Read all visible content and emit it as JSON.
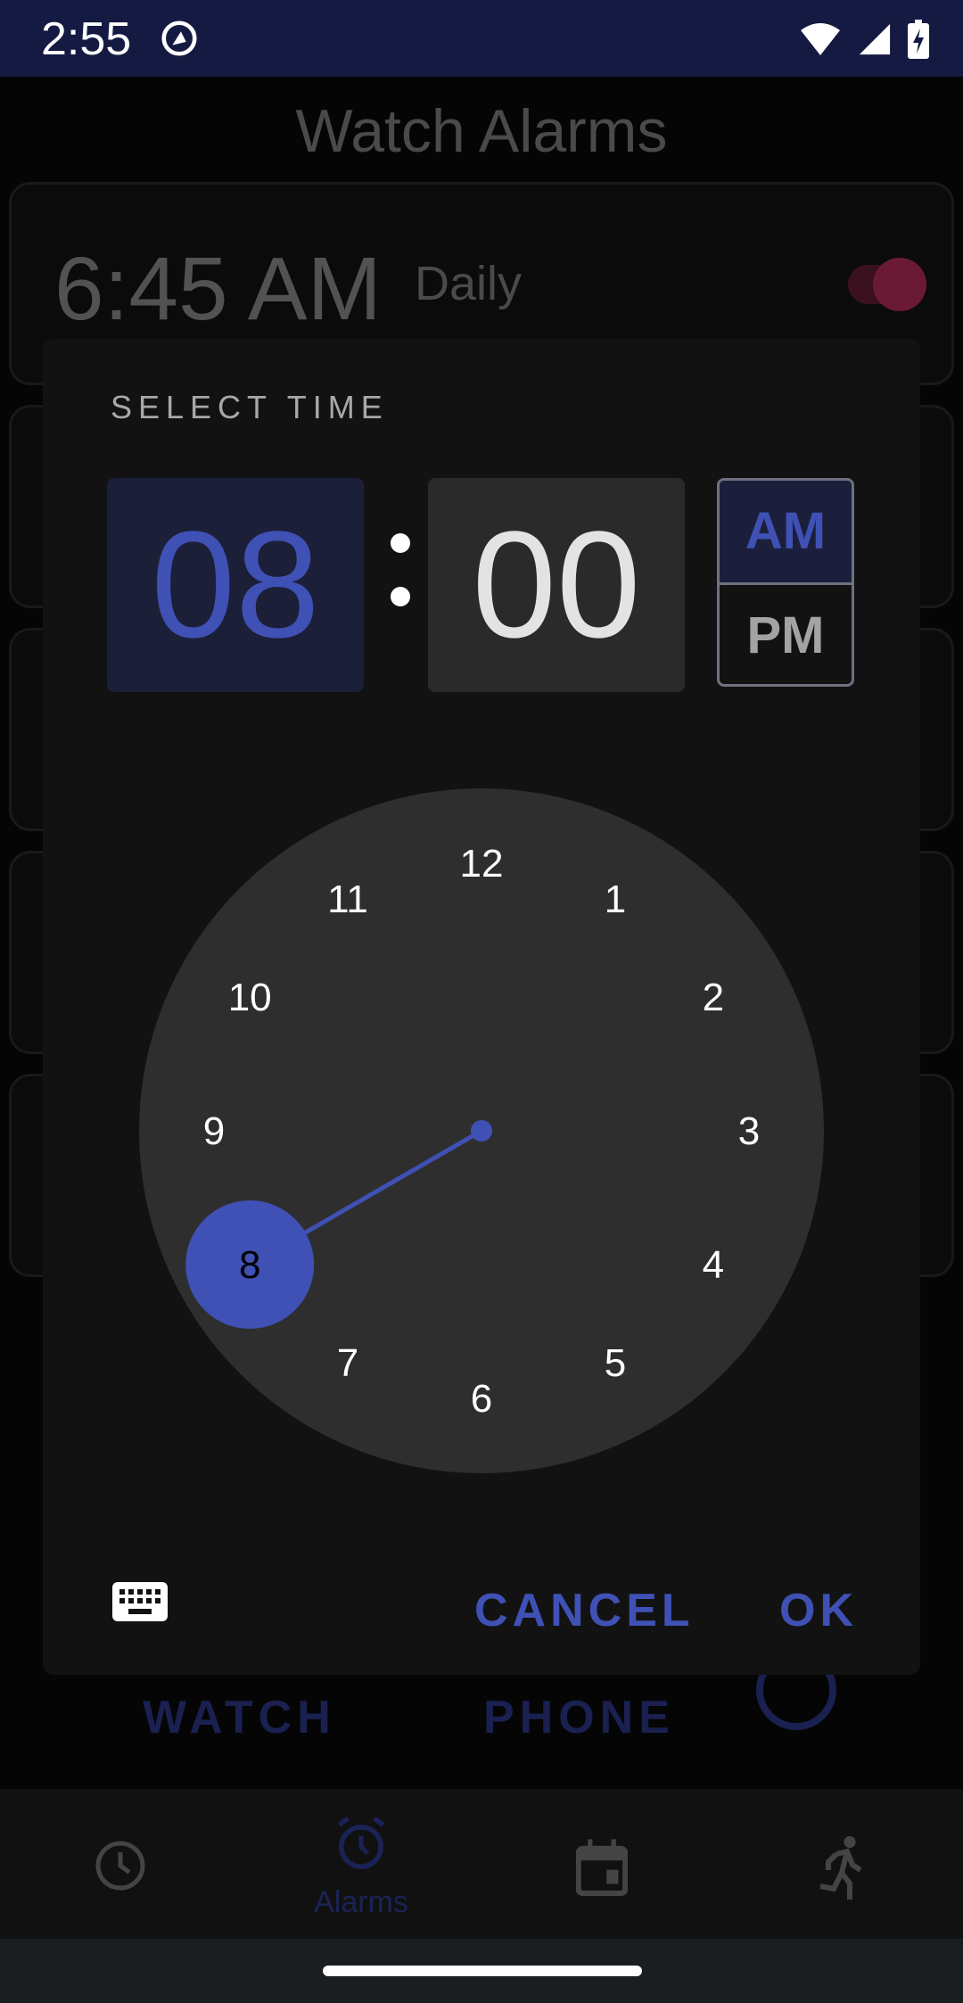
{
  "status_bar": {
    "time": "2:55",
    "icons": [
      "dnd-icon",
      "wifi-icon",
      "signal-icon",
      "battery-charging-icon"
    ]
  },
  "app": {
    "title": "Watch Alarms",
    "alarms": [
      {
        "time": "6:45 AM",
        "repeat": "Daily",
        "enabled": true
      }
    ],
    "actions": {
      "send_to_watch": "WATCH",
      "send_to_phone": "PHONE",
      "info_icon": "info-icon"
    },
    "bottom_nav": [
      {
        "icon": "clock-icon",
        "label": "",
        "selected": false
      },
      {
        "icon": "alarm-icon",
        "label": "Alarms",
        "selected": true
      },
      {
        "icon": "calendar-icon",
        "label": "",
        "selected": false
      },
      {
        "icon": "run-icon",
        "label": "",
        "selected": false
      }
    ]
  },
  "dialog": {
    "heading": "SELECT TIME",
    "hour": "08",
    "minute": "00",
    "separator": ":",
    "am_label": "AM",
    "pm_label": "PM",
    "period_selected": "AM",
    "clock": {
      "numbers": [
        "12",
        "1",
        "2",
        "3",
        "4",
        "5",
        "6",
        "7",
        "8",
        "9",
        "10",
        "11"
      ],
      "selected": "8"
    },
    "keyboard_icon": "keyboard-icon",
    "cancel_label": "CANCEL",
    "ok_label": "OK"
  },
  "colors": {
    "accent": "#3f51b5",
    "statusbar": "#151a42",
    "dialog_bg": "#121212",
    "clock_face": "#2e2e2e"
  }
}
